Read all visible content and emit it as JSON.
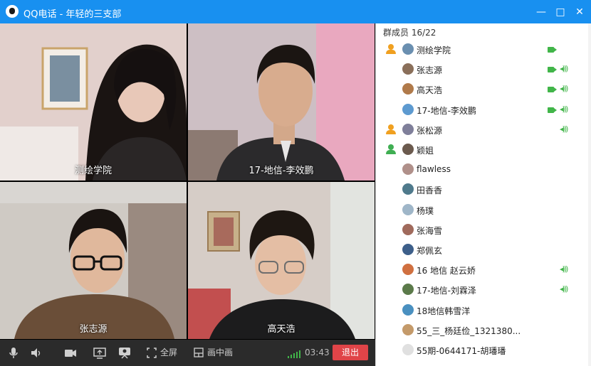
{
  "window": {
    "title": "QQ电话 - 年轻的三支部",
    "controls": {
      "minimize": "—",
      "maximize": "□",
      "close": "✕"
    }
  },
  "video_tiles": [
    {
      "label": "测绘学院"
    },
    {
      "label": "17-地信-李效鹏"
    },
    {
      "label": "张志源"
    },
    {
      "label": "高天浩"
    }
  ],
  "controls": {
    "fullscreen_label": "全屏",
    "pip_label": "画中画",
    "timer": "03:43",
    "exit_label": "退出"
  },
  "panel": {
    "member_count": "群成员 16/22",
    "members": [
      {
        "name": "测绘学院",
        "role": "admin",
        "camera": true,
        "speaker": false
      },
      {
        "name": "张志源",
        "role": "",
        "camera": true,
        "speaker": true
      },
      {
        "name": "高天浩",
        "role": "",
        "camera": true,
        "speaker": true
      },
      {
        "name": "17-地信-李效鹏",
        "role": "",
        "camera": true,
        "speaker": true
      },
      {
        "name": "张松源",
        "role": "admin",
        "camera": false,
        "speaker": true
      },
      {
        "name": "颖姐",
        "role": "owner",
        "camera": false,
        "speaker": false
      },
      {
        "name": "flawless",
        "role": "",
        "camera": false,
        "speaker": false
      },
      {
        "name": "田香香",
        "role": "",
        "camera": false,
        "speaker": false
      },
      {
        "name": "杨璞",
        "role": "",
        "camera": false,
        "speaker": false
      },
      {
        "name": "张海雪",
        "role": "",
        "camera": false,
        "speaker": false
      },
      {
        "name": "郑佩玄",
        "role": "",
        "camera": false,
        "speaker": false
      },
      {
        "name": "16 地信 赵云娇",
        "role": "",
        "camera": false,
        "speaker": true
      },
      {
        "name": "17-地信-刘霖泽",
        "role": "",
        "camera": false,
        "speaker": true
      },
      {
        "name": "18地信韩雪洋",
        "role": "",
        "camera": false,
        "speaker": false
      },
      {
        "name": "55_三_杨廷俭_1321380...",
        "role": "",
        "camera": false,
        "speaker": false
      },
      {
        "name": "55期-0644171-胡璠璠",
        "role": "",
        "camera": false,
        "speaker": false
      }
    ]
  },
  "colors": {
    "titlebar": "#1890f0",
    "exit": "#e04448",
    "active": "#41b549",
    "admin": "#f0a020",
    "owner": "#3fae52"
  }
}
